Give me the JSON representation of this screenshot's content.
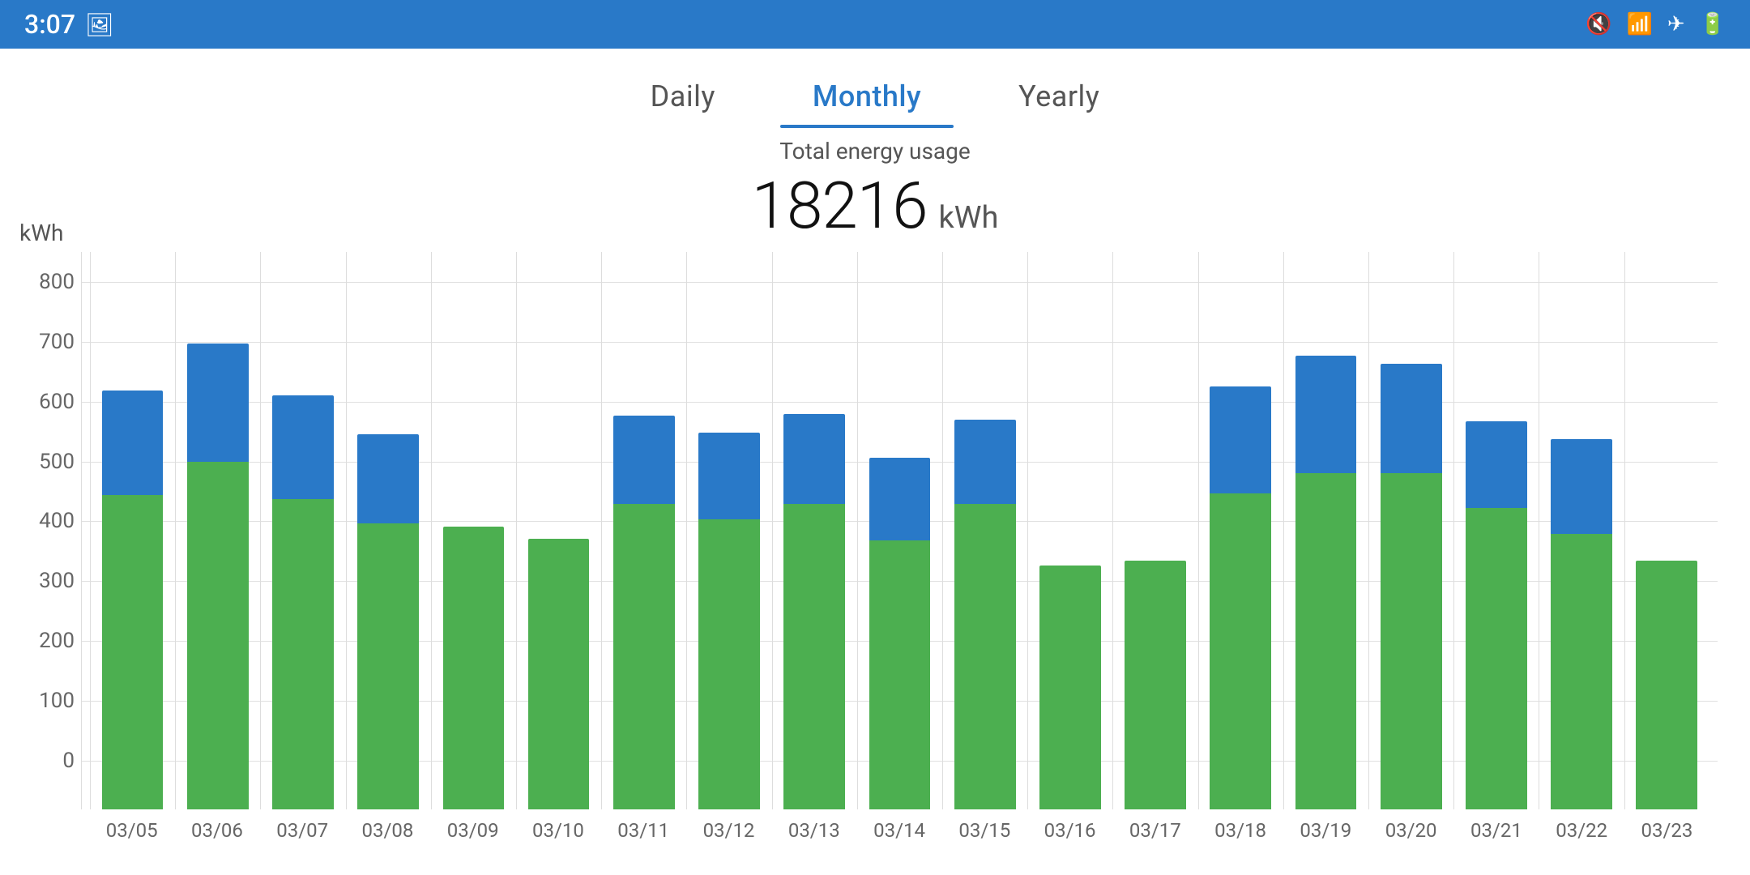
{
  "statusBar": {
    "time": "3:07",
    "icons": [
      "🖼",
      "🔇",
      "📶",
      "✈",
      "🔋"
    ]
  },
  "tabs": [
    {
      "id": "daily",
      "label": "Daily",
      "active": false
    },
    {
      "id": "monthly",
      "label": "Monthly",
      "active": true
    },
    {
      "id": "yearly",
      "label": "Yearly",
      "active": false
    }
  ],
  "summary": {
    "label": "Total energy usage",
    "value": "18216",
    "unit": "kWh"
  },
  "yAxis": {
    "label": "kWh",
    "ticks": [
      "800",
      "700",
      "600",
      "500",
      "400",
      "300",
      "200",
      "100",
      "0"
    ]
  },
  "bars": [
    {
      "date": "03/05",
      "total": 700,
      "green": 525
    },
    {
      "date": "03/06",
      "total": 778,
      "green": 580
    },
    {
      "date": "03/07",
      "total": 692,
      "green": 518
    },
    {
      "date": "03/08",
      "total": 627,
      "green": 478
    },
    {
      "date": "03/09",
      "total": 472,
      "green": 472
    },
    {
      "date": "03/10",
      "total": 452,
      "green": 452
    },
    {
      "date": "03/11",
      "total": 658,
      "green": 510
    },
    {
      "date": "03/12",
      "total": 630,
      "green": 484
    },
    {
      "date": "03/13",
      "total": 661,
      "green": 510
    },
    {
      "date": "03/14",
      "total": 588,
      "green": 450
    },
    {
      "date": "03/15",
      "total": 651,
      "green": 510
    },
    {
      "date": "03/16",
      "total": 407,
      "green": 407
    },
    {
      "date": "03/17",
      "total": 416,
      "green": 416
    },
    {
      "date": "03/18",
      "total": 706,
      "green": 528
    },
    {
      "date": "03/19",
      "total": 758,
      "green": 562
    },
    {
      "date": "03/20",
      "total": 744,
      "green": 562
    },
    {
      "date": "03/21",
      "total": 648,
      "green": 503
    },
    {
      "date": "03/22",
      "total": 618,
      "green": 460
    },
    {
      "date": "03/23",
      "total": 415,
      "green": 415
    }
  ],
  "chartMax": 850
}
